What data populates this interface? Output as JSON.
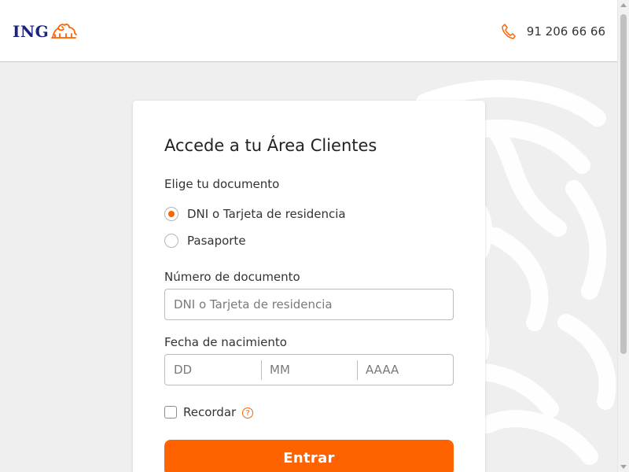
{
  "header": {
    "logo_text": "ING",
    "phone_number": "91 206 66 66"
  },
  "login": {
    "title": "Accede a tu Área Clientes",
    "document_label": "Elige tu documento",
    "document_options": [
      {
        "label": "DNI o Tarjeta de residencia",
        "selected": true
      },
      {
        "label": "Pasaporte",
        "selected": false
      }
    ],
    "document_number_label": "Número de documento",
    "document_number_placeholder": "DNI o Tarjeta de residencia",
    "birthdate_label": "Fecha de nacimiento",
    "birthdate_placeholders": {
      "day": "DD",
      "month": "MM",
      "year": "AAAA"
    },
    "remember_label": "Recordar",
    "remember_checked": false,
    "help_symbol": "?",
    "submit_label": "Entrar"
  },
  "colors": {
    "brand_orange": "#ff6200",
    "brand_blue": "#1a237e"
  },
  "icons": {
    "logo": "ing-lion-icon",
    "phone": "phone-icon",
    "help": "help-circle-icon",
    "background": "lion-watermark-icon"
  }
}
